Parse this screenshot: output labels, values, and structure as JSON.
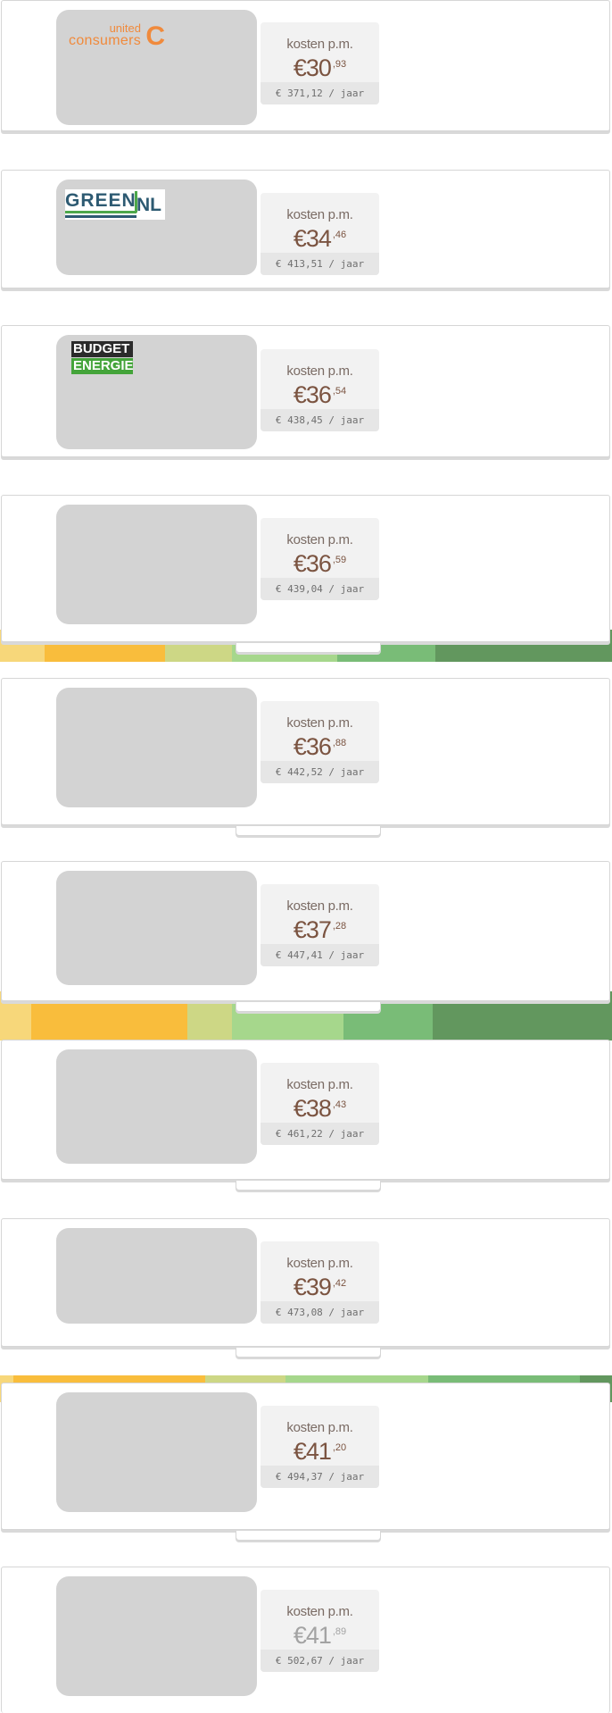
{
  "colors": {
    "price": "#7b5441",
    "label": "#7a6b64",
    "uc_orange": "#f08a3c",
    "greennl_blue": "#2d5a72",
    "greennl_green": "#4ca84a",
    "budget_dark": "#2b2b2b",
    "budget_green": "#44a43a"
  },
  "offers": [
    {
      "logo": "united-consumers",
      "logo_text_1": "united",
      "logo_text_2": "consumers",
      "logo_mark": "C",
      "label": "kosten p.m.",
      "price_main": "€30",
      "price_cents": ",93",
      "yearly": "€ 371,12 / jaar"
    },
    {
      "logo": "green-nl",
      "logo_text_1": "GREEN",
      "logo_text_2": "NL",
      "label": "kosten p.m.",
      "price_main": "€34",
      "price_cents": ",46",
      "yearly": "€ 413,51 / jaar"
    },
    {
      "logo": "budget-energie",
      "logo_text_1": "BUDGET",
      "logo_text_2": "ENERGIE",
      "label": "kosten p.m.",
      "price_main": "€36",
      "price_cents": ",54",
      "yearly": "€ 438,45 / jaar"
    },
    {
      "logo": "",
      "label": "kosten p.m.",
      "price_main": "€36",
      "price_cents": ",59",
      "yearly": "€ 439,04 / jaar"
    },
    {
      "logo": "",
      "label": "kosten p.m.",
      "price_main": "€36",
      "price_cents": ",88",
      "yearly": "€ 442,52 / jaar"
    },
    {
      "logo": "",
      "label": "kosten p.m.",
      "price_main": "€37",
      "price_cents": ",28",
      "yearly": "€ 447,41 / jaar"
    },
    {
      "logo": "",
      "label": "kosten p.m.",
      "price_main": "€38",
      "price_cents": ",43",
      "yearly": "€ 461,22 / jaar"
    },
    {
      "logo": "",
      "label": "kosten p.m.",
      "price_main": "€39",
      "price_cents": ",42",
      "yearly": "€ 473,08 / jaar"
    },
    {
      "logo": "",
      "label": "kosten p.m.",
      "price_main": "€41",
      "price_cents": ",20",
      "yearly": "€ 494,37 / jaar"
    },
    {
      "logo": "",
      "label": "kosten p.m.",
      "price_main": "€41",
      "price_cents": ",89",
      "yearly": "€ 502,67 / jaar"
    }
  ]
}
